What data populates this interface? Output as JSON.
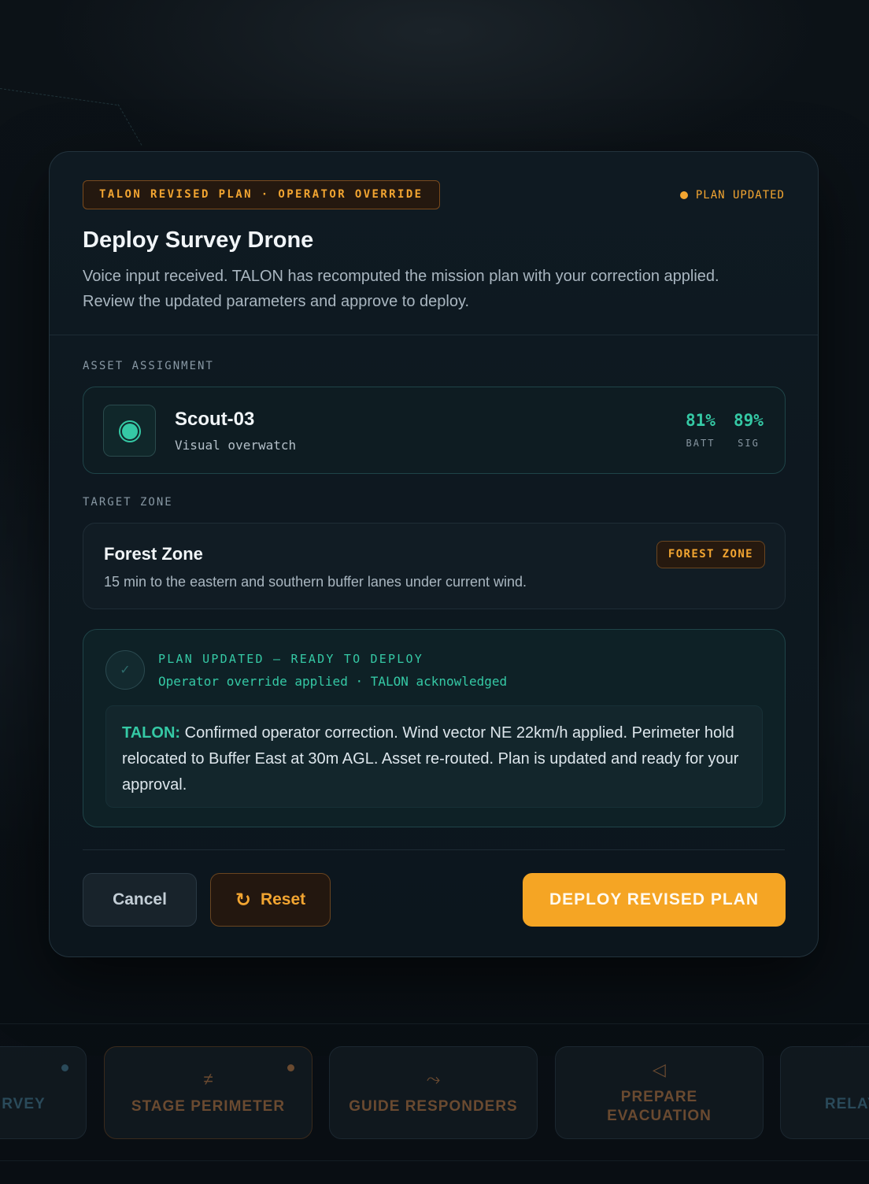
{
  "plan_tag": "TALON REVISED PLAN · OPERATOR OVERRIDE",
  "status": "PLAN UPDATED",
  "title": "Deploy Survey Drone",
  "description": "Voice input received. TALON has recomputed the mission plan with your correction applied. Review the updated parameters and approve to deploy.",
  "asset_section_label": "ASSET ASSIGNMENT",
  "asset": {
    "name": "Scout-03",
    "role": "Visual overwatch",
    "battery": "81%",
    "battery_label": "BATT",
    "signal": "89%",
    "signal_label": "SIG"
  },
  "zone_section_label": "TARGET ZONE",
  "zone": {
    "name": "Forest Zone",
    "description": "15 min to the eastern and southern buffer lanes under current wind.",
    "badge": "FOREST ZONE"
  },
  "confirmation": {
    "title": "PLAN UPDATED — READY TO DEPLOY",
    "subtitle": "Operator override applied · TALON acknowledged",
    "message_lead": "TALON:",
    "message": "Confirmed operator correction. Wind vector NE 22km/h applied. Perimeter hold relocated to Buffer East at 30m AGL. Asset re-routed. Plan is updated and ready for your approval."
  },
  "buttons": {
    "cancel": "Cancel",
    "reset": "Reset",
    "deploy": "DEPLOY REVISED PLAN"
  },
  "quick_actions": [
    {
      "label": "RVEY",
      "icon": "survey-icon"
    },
    {
      "label": "STAGE PERIMETER",
      "icon": "perimeter-icon"
    },
    {
      "label": "GUIDE RESPONDERS",
      "icon": "route-icon"
    },
    {
      "label": "PREPARE EVACUATION",
      "icon": "megaphone-icon"
    },
    {
      "label": "RELAY F",
      "icon": "relay-icon"
    }
  ],
  "colors": {
    "accent_orange": "#f5a524",
    "accent_teal": "#35c9a5",
    "background": "#0b1117"
  }
}
